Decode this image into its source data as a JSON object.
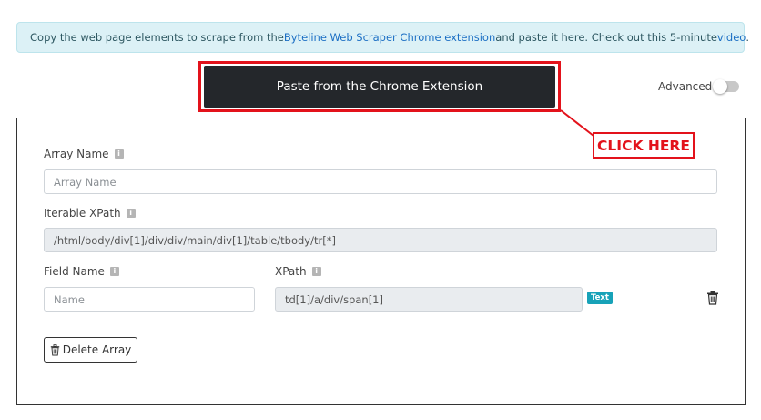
{
  "info_bar": {
    "text_before": "Copy the web page elements to scrape from the ",
    "link_text": "Byteline Web Scraper Chrome extension",
    "text_middle": " and paste it here. Check out this 5-minute ",
    "video_link": "video",
    "text_after": "."
  },
  "paste_button": {
    "label": "Paste from the Chrome Extension"
  },
  "advanced": {
    "label": "Advanced",
    "enabled": false
  },
  "callout": {
    "text": "CLICK HERE",
    "color": "#e3121b"
  },
  "form": {
    "array_name": {
      "label": "Array Name",
      "placeholder": "Array Name",
      "value": ""
    },
    "iterable_xpath": {
      "label": "Iterable XPath",
      "value": "/html/body/div[1]/div/div/main/div[1]/table/tbody/tr[*]"
    },
    "field_name": {
      "label": "Field Name",
      "placeholder": "Name",
      "value": ""
    },
    "xpath": {
      "label": "XPath",
      "value": "td[1]/a/div/span[1]"
    },
    "type_badge": "Text",
    "delete_button": {
      "label": "Delete Array"
    }
  },
  "icons": {
    "info": "info-icon",
    "trash": "trash-icon"
  },
  "colors": {
    "accent_red": "#e3121b",
    "button_dark": "#24272b",
    "badge_teal": "#17a2b8",
    "info_bg": "#dcf1f6"
  }
}
